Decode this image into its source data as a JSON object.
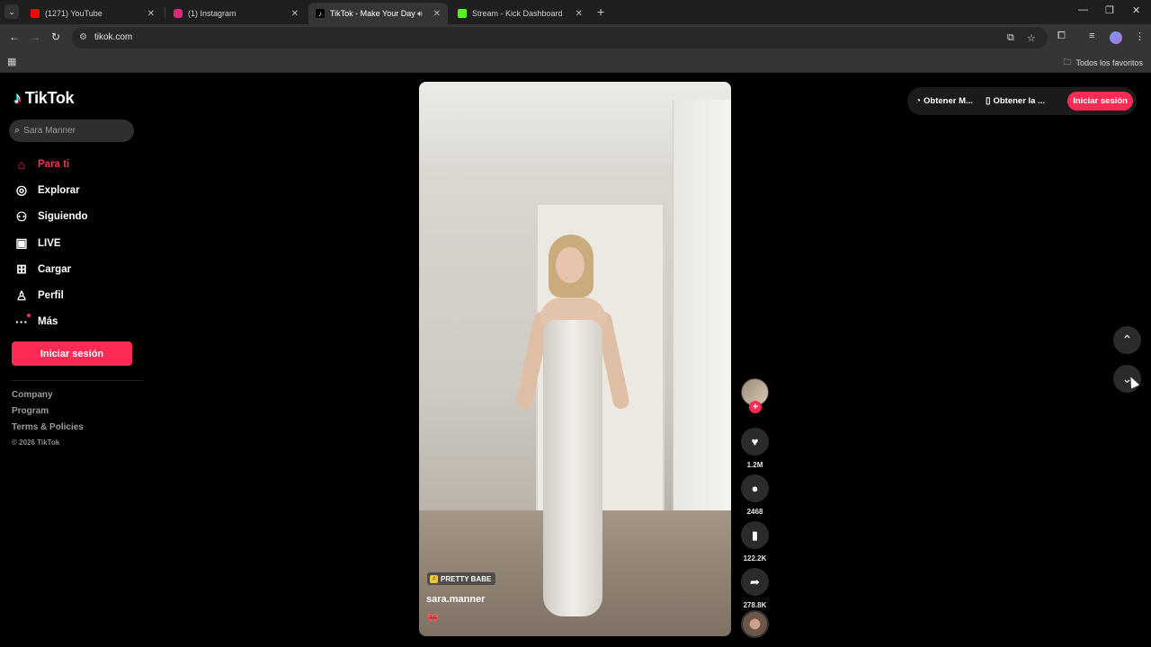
{
  "browser": {
    "tabs": [
      {
        "title": "(1271) YouTube",
        "favicon_color": "#ff0000",
        "active": false
      },
      {
        "title": "(1) Instagram",
        "favicon_color": "#d62976",
        "active": false
      },
      {
        "title": "TikTok - Make Your Day",
        "favicon_color": "#000000",
        "active": true
      },
      {
        "title": "Stream - Kick Dashboard",
        "favicon_color": "#53fc18",
        "active": false
      }
    ],
    "url": "tikok.com",
    "bookmarks_folder": "Todos los favoritos",
    "icons": {
      "tab_menu": "chevron-down-icon",
      "new_tab": "plus-icon",
      "minimize": "minimize-icon",
      "maximize": "restore-icon",
      "close": "close-icon",
      "back": "back-arrow-icon",
      "forward": "forward-arrow-icon",
      "reload": "reload-icon",
      "site_info": "site-info-icon",
      "install": "install-app-icon",
      "bookmark": "star-icon",
      "extensions": "puzzle-icon",
      "media": "media-control-icon",
      "menu": "kebab-menu-icon",
      "apps": "apps-grid-icon",
      "folder": "folder-icon"
    }
  },
  "tiktok": {
    "brand": "TikTok",
    "search": {
      "placeholder": "Sara Manner"
    },
    "nav": [
      {
        "label": "Para ti",
        "icon": "home-icon",
        "active": true
      },
      {
        "label": "Explorar",
        "icon": "compass-icon",
        "active": false
      },
      {
        "label": "Siguiendo",
        "icon": "following-icon",
        "active": false
      },
      {
        "label": "LIVE",
        "icon": "live-tv-icon",
        "active": false
      },
      {
        "label": "Cargar",
        "icon": "upload-icon",
        "active": false
      },
      {
        "label": "Perfil",
        "icon": "profile-icon",
        "active": false
      },
      {
        "label": "Más",
        "icon": "more-icon",
        "active": false
      }
    ],
    "login_label": "Iniciar sesión",
    "footer": {
      "links": [
        "Company",
        "Program",
        "Terms & Policies"
      ],
      "copyright": "© 2026 TikTok"
    },
    "topbar": {
      "get_coins": "Obtener M...",
      "get_app": "Obtener la ...",
      "login": "Iniciar sesión"
    },
    "video": {
      "badge": "PRETTY BABE",
      "username": "sara.manner",
      "caption_emoji": "🎀"
    },
    "actions": {
      "likes": "1.2M",
      "comments": "2468",
      "saves": "122.2K",
      "shares": "278.8K"
    },
    "colors": {
      "accent": "#fe2c55",
      "background": "#000000",
      "control_bg": "#2b2b2b"
    }
  }
}
